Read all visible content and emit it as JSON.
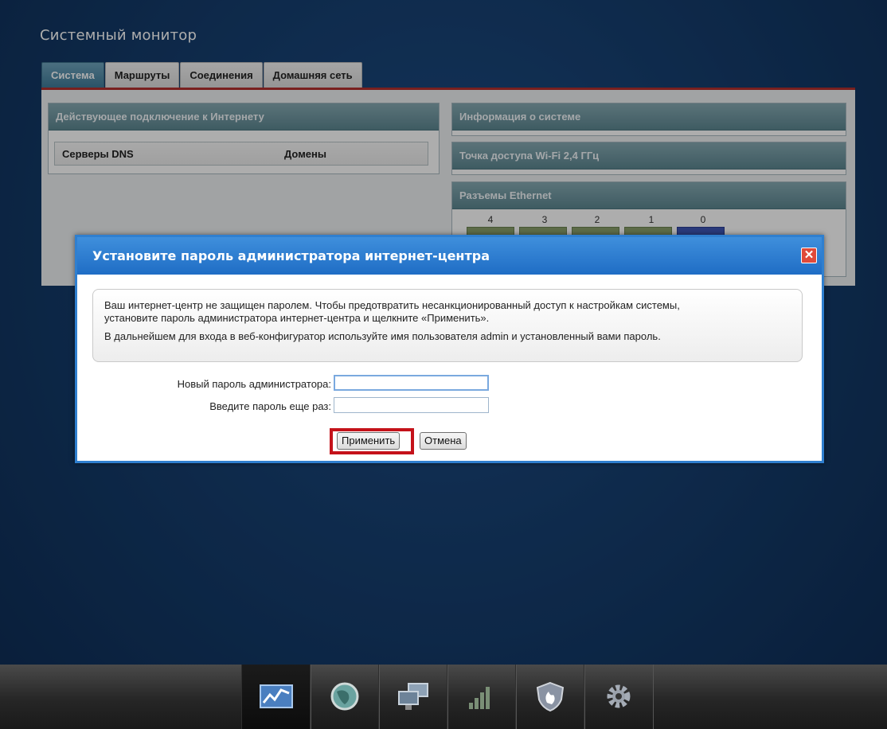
{
  "page": {
    "title": "Системный монитор"
  },
  "tabs": [
    "Система",
    "Маршруты",
    "Соединения",
    "Домашняя сеть"
  ],
  "left_panel": {
    "header": "Действующее подключение к Интернету",
    "dns_label": "Серверы DNS",
    "domains_label": "Домены"
  },
  "right_panel": {
    "system_info": "Информация о системе",
    "wifi": "Точка доступа Wi-Fi 2,4 ГГц",
    "ethernet": "Разъемы Ethernet",
    "ports": [
      "4",
      "3",
      "2",
      "1",
      "0"
    ]
  },
  "dialog": {
    "title": "Установите пароль администратора интернет-центра",
    "close_icon": "close-icon",
    "notice_line1": "Ваш интернет-центр не защищен паролем. Чтобы предотвратить несанкционированный доступ к настройкам системы,",
    "notice_line2": "установите пароль администратора интернет-центра и щелкните «Применить».",
    "notice_line3": "В дальнейшем для входа в веб-конфигуратор используйте имя пользователя admin и установленный вами пароль.",
    "new_password_label": "Новый пароль администратора:",
    "new_password_value": "",
    "repeat_password_label": "Введите пароль еще раз:",
    "repeat_password_value": "",
    "apply_label": "Применить",
    "cancel_label": "Отмена"
  },
  "taskbar": [
    "monitor-icon",
    "globe-icon",
    "network-computers-icon",
    "wifi-signal-icon",
    "shield-icon",
    "gear-icon"
  ],
  "colors": {
    "accent_red": "#c4121a",
    "dialog_blue": "#2f7fcf",
    "tab_active": "#3f7b99"
  }
}
